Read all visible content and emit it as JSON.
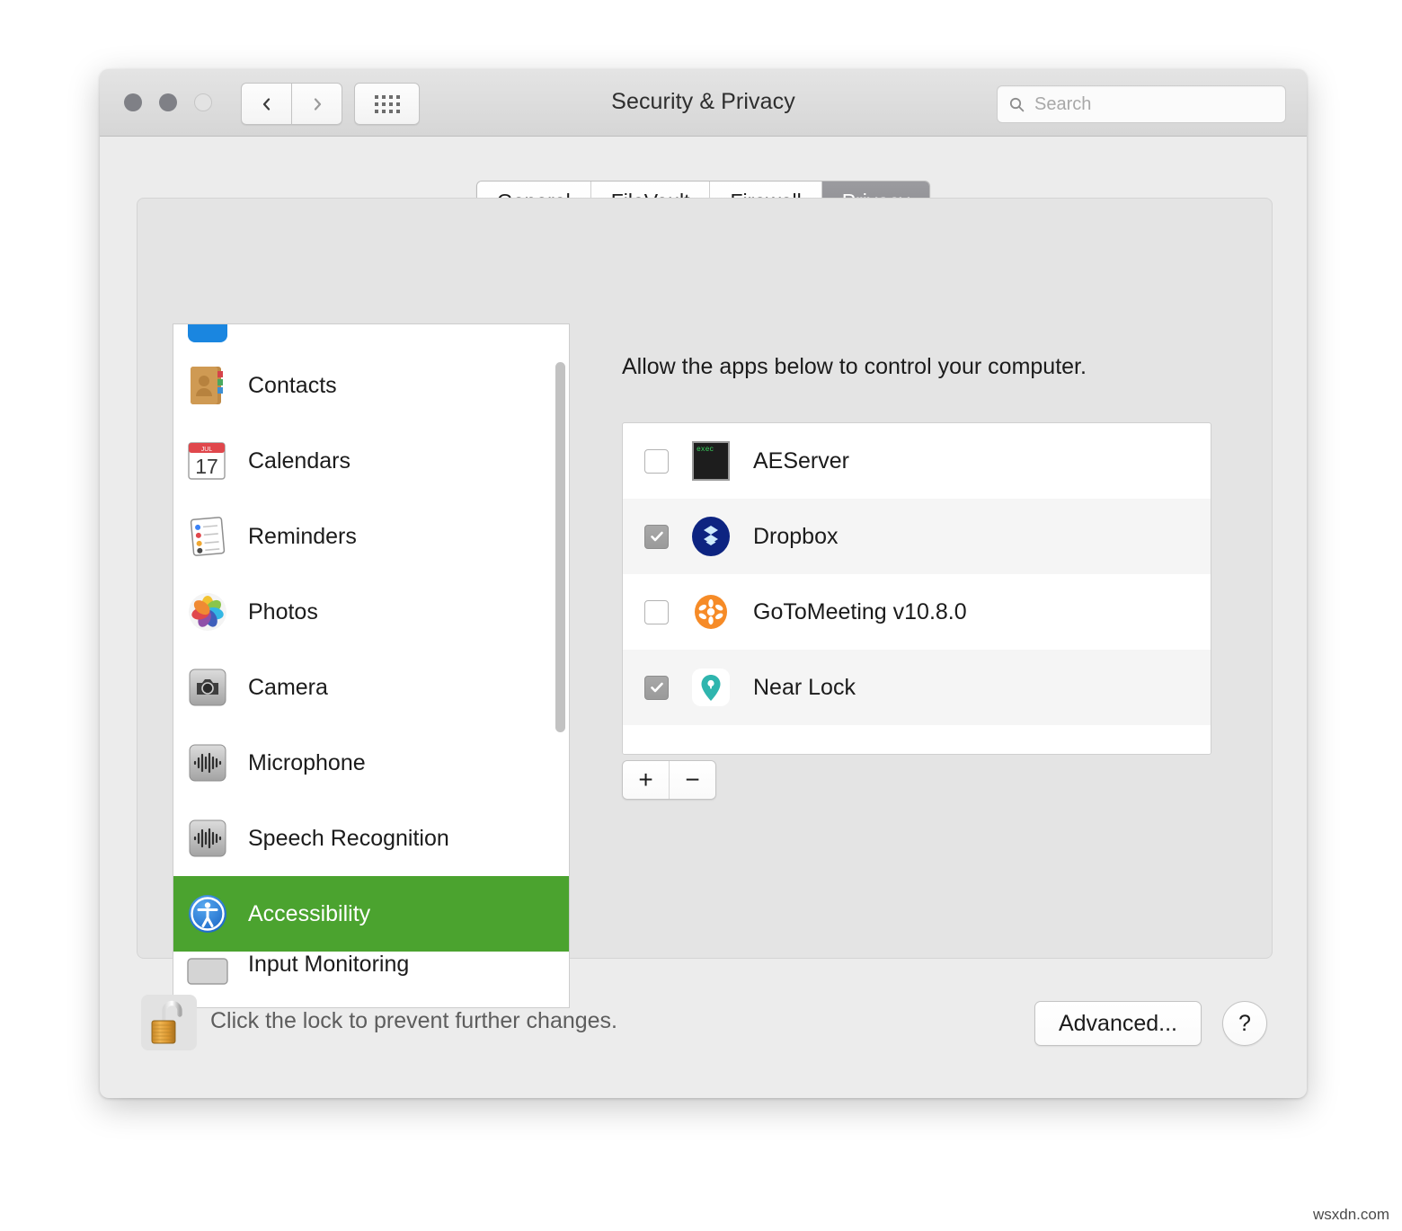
{
  "window": {
    "title": "Security & Privacy",
    "traffic_lights": [
      "close",
      "minimize",
      "zoom"
    ],
    "nav": {
      "back_icon": "chevron-left-icon",
      "forward_icon": "chevron-right-icon",
      "showall_icon": "grid-icon"
    }
  },
  "search": {
    "placeholder": "Search",
    "value": "",
    "icon": "search-icon"
  },
  "tabs": [
    {
      "label": "General",
      "active": false
    },
    {
      "label": "FileVault",
      "active": false
    },
    {
      "label": "Firewall",
      "active": false
    },
    {
      "label": "Privacy",
      "active": true
    }
  ],
  "sidebar": {
    "items": [
      {
        "label": "",
        "icon": "location-services-icon",
        "partial": "top",
        "selected": false
      },
      {
        "label": "Contacts",
        "icon": "contacts-icon",
        "selected": false
      },
      {
        "label": "Calendars",
        "icon": "calendar-icon",
        "selected": false
      },
      {
        "label": "Reminders",
        "icon": "reminders-icon",
        "selected": false
      },
      {
        "label": "Photos",
        "icon": "photos-icon",
        "selected": false
      },
      {
        "label": "Camera",
        "icon": "camera-icon",
        "selected": false
      },
      {
        "label": "Microphone",
        "icon": "microphone-icon",
        "selected": false
      },
      {
        "label": "Speech Recognition",
        "icon": "speech-recognition-icon",
        "selected": false
      },
      {
        "label": "Accessibility",
        "icon": "accessibility-icon",
        "selected": true
      },
      {
        "label": "Input Monitoring",
        "icon": "input-monitoring-icon",
        "partial": "bottom",
        "selected": false
      }
    ],
    "selected_highlight_color": "#4ba32f"
  },
  "content": {
    "description": "Allow the apps below to control your computer.",
    "apps": [
      {
        "name": "AEServer",
        "checked": false,
        "icon": "aeserver-exec-icon"
      },
      {
        "name": "Dropbox",
        "checked": true,
        "icon": "dropbox-icon"
      },
      {
        "name": "GoToMeeting v10.8.0",
        "checked": false,
        "icon": "gotomeeting-icon"
      },
      {
        "name": "Near Lock",
        "checked": true,
        "icon": "near-lock-icon"
      }
    ],
    "add_label": "+",
    "remove_label": "−"
  },
  "bottom": {
    "lock_icon": "unlocked-padlock-icon",
    "lock_text": "Click the lock to prevent further changes.",
    "advanced_label": "Advanced...",
    "help_label": "?"
  },
  "watermark": "wsxdn.com",
  "colors": {
    "selection_green": "#4ba32f",
    "tab_active_gray": "#919196",
    "dropbox_blue": "#0d2481",
    "gotomeeting_orange": "#f68b27",
    "near_lock_teal": "#2fb5ae",
    "aeserver_terminal_green": "#3ad45e"
  }
}
